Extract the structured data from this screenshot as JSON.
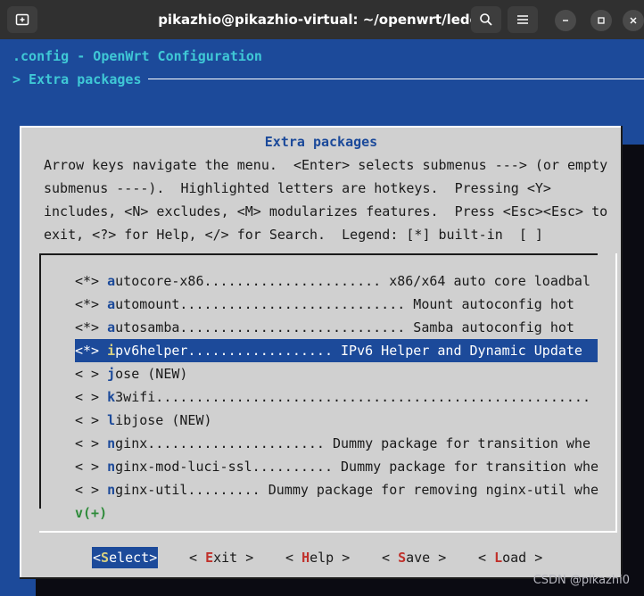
{
  "window": {
    "title": "pikazhio@pikazhio-virtual: ~/openwrt/lede"
  },
  "terminal": {
    "header_line1": ".config - OpenWrt Configuration",
    "header_line2": "> Extra packages "
  },
  "dialog": {
    "title": "Extra packages",
    "help_lines": [
      "Arrow keys navigate the menu.  <Enter> selects submenus ---> (or empty",
      "submenus ----).  Highlighted letters are hotkeys.  Pressing <Y>",
      "includes, <N> excludes, <M> modularizes features.  Press <Esc><Esc> to",
      "exit, <?> for Help, </> for Search.  Legend: [*] built-in  [ ]"
    ],
    "items": [
      {
        "state": "<*> ",
        "hotkey": "a",
        "rest": "utocore-x86...................... x86/x64 auto core loadbal"
      },
      {
        "state": "<*> ",
        "hotkey": "a",
        "rest": "utomount............................ Mount autoconfig hot"
      },
      {
        "state": "<*> ",
        "hotkey": "a",
        "rest": "utosamba............................ Samba autoconfig hot"
      },
      {
        "state": "<*> ",
        "hotkey": "i",
        "rest": "pv6helper.................. IPv6 Helper and Dynamic Update"
      },
      {
        "state": "< > ",
        "hotkey": "j",
        "rest": "ose (NEW)"
      },
      {
        "state": "< > ",
        "hotkey": "k",
        "rest": "3wifi......................................................"
      },
      {
        "state": "< > ",
        "hotkey": "l",
        "rest": "ibjose (NEW)"
      },
      {
        "state": "< > ",
        "hotkey": "n",
        "rest": "ginx...................... Dummy package for transition whe"
      },
      {
        "state": "< > ",
        "hotkey": "n",
        "rest": "ginx-mod-luci-ssl.......... Dummy package for transition whe"
      },
      {
        "state": "< > ",
        "hotkey": "n",
        "rest": "ginx-util......... Dummy package for removing nginx-util whe"
      }
    ],
    "more_indicator": "v(+)",
    "buttons": [
      {
        "pre": "<",
        "hotkey": "S",
        "post": "elect>"
      },
      {
        "pre": "< ",
        "hotkey": "E",
        "post": "xit >"
      },
      {
        "pre": "< ",
        "hotkey": "H",
        "post": "elp >"
      },
      {
        "pre": "< ",
        "hotkey": "S",
        "post": "ave >"
      },
      {
        "pre": "< ",
        "hotkey": "L",
        "post": "oad >"
      }
    ]
  },
  "watermark": "CSDN @pikazhi0",
  "colors": {
    "terminal_bg": "#1c4a9a",
    "dialog_bg": "#d0d0d0",
    "selection_bg": "#1c4a9a",
    "header_text": "#3fc8d6",
    "button_hotkey": "#c0302a",
    "more_indicator": "#2e8b3a"
  },
  "icons": [
    "new-tab-icon",
    "search-icon",
    "hamburger-menu-icon",
    "minimize-icon",
    "maximize-icon",
    "close-icon"
  ]
}
